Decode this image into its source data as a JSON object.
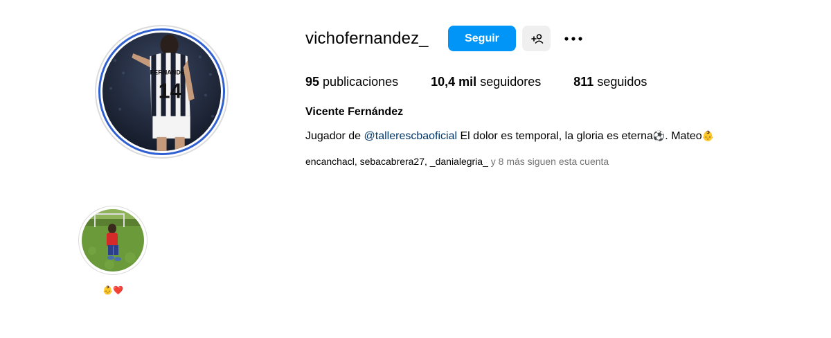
{
  "profile": {
    "username": "vichofernandez_",
    "full_name": "Vicente Fernández",
    "jersey_name": "FERNANDEZ",
    "jersey_number": "14"
  },
  "actions": {
    "follow_label": "Seguir",
    "suggest_icon": "add-person-icon",
    "more_icon": "more-options-icon"
  },
  "stats": {
    "posts_value": "95",
    "posts_label": "publicaciones",
    "followers_value": "10,4 mil",
    "followers_label": "seguidores",
    "following_value": "811",
    "following_label": "seguidos"
  },
  "bio": {
    "prefix": "Jugador de ",
    "mention": "@tallerescbaoficial",
    "text": " El dolor es temporal, la gloria es eterna",
    "emoji_ball": "⚽",
    "text2": ". Mateo",
    "emoji_baby": "👶"
  },
  "followed_by": {
    "names": [
      "encanchacl",
      "sebacabrera27",
      "_danialegria_"
    ],
    "more": "y 8 más siguen esta cuenta"
  },
  "highlights": [
    {
      "label": "👶❤️"
    }
  ],
  "colors": {
    "primary": "#0095f6",
    "story_ring": "#2f5fd0",
    "mention": "#00376b",
    "secondary_text": "#737373"
  }
}
